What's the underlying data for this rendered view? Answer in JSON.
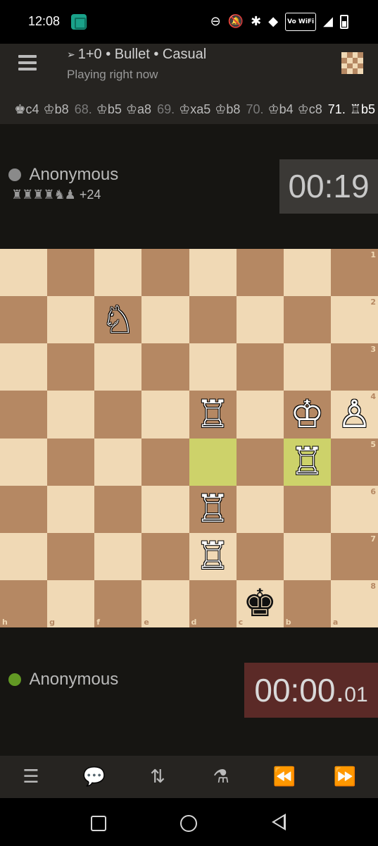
{
  "status_bar": {
    "time": "12:08",
    "wifi_label": "Vo WiFi"
  },
  "header": {
    "title": "1+0 • Bullet • Casual",
    "subtitle": "Playing right now"
  },
  "moves": [
    {
      "num": "",
      "move": "♚c4",
      "faded": true
    },
    {
      "num": "",
      "move": "♔b8"
    },
    {
      "num": "68.",
      "move": "♔b5"
    },
    {
      "num": "",
      "move": "♔a8"
    },
    {
      "num": "69.",
      "move": "♔xa5"
    },
    {
      "num": "",
      "move": "♔b8"
    },
    {
      "num": "70.",
      "move": "♔b4"
    },
    {
      "num": "",
      "move": "♔c8"
    },
    {
      "num": "71.",
      "move": "♖b5",
      "last": true
    }
  ],
  "opponent": {
    "name": "Anonymous",
    "dot_color": "#8a8a8a",
    "captured": "♜♜♜♜♞♟",
    "material_diff": "+24",
    "clock": "00:19"
  },
  "player": {
    "name": "Anonymous",
    "dot_color": "#629924",
    "clock_main": "00:00.",
    "clock_fraction": "01"
  },
  "board": {
    "orientation": "black",
    "files": [
      "h",
      "g",
      "f",
      "e",
      "d",
      "c",
      "b",
      "a"
    ],
    "ranks": [
      "1",
      "2",
      "3",
      "4",
      "5",
      "6",
      "7",
      "8"
    ],
    "last_move": [
      "d5",
      "b5"
    ],
    "pieces": [
      {
        "square": "f2",
        "piece": "♘",
        "color": "w",
        "name": "white-knight"
      },
      {
        "square": "d4",
        "piece": "♖",
        "color": "w",
        "name": "white-rook"
      },
      {
        "square": "b4",
        "piece": "♔",
        "color": "w",
        "name": "white-king"
      },
      {
        "square": "a4",
        "piece": "♙",
        "color": "w",
        "name": "white-pawn"
      },
      {
        "square": "b5",
        "piece": "♖",
        "color": "w",
        "name": "white-rook"
      },
      {
        "square": "d6",
        "piece": "♖",
        "color": "w",
        "name": "white-rook"
      },
      {
        "square": "d7",
        "piece": "♖",
        "color": "w",
        "name": "white-rook"
      },
      {
        "square": "c8",
        "piece": "♚",
        "color": "b",
        "name": "black-king"
      }
    ]
  },
  "toolbar": {
    "buttons": [
      {
        "name": "moves-list-button",
        "glyph": "☰"
      },
      {
        "name": "chat-button",
        "glyph": "💬"
      },
      {
        "name": "flip-board-button",
        "glyph": "⇅"
      },
      {
        "name": "analysis-button",
        "glyph": "⚗"
      },
      {
        "name": "previous-move-button",
        "glyph": "⏪"
      },
      {
        "name": "next-move-button",
        "glyph": "⏩",
        "disabled": true
      }
    ]
  }
}
